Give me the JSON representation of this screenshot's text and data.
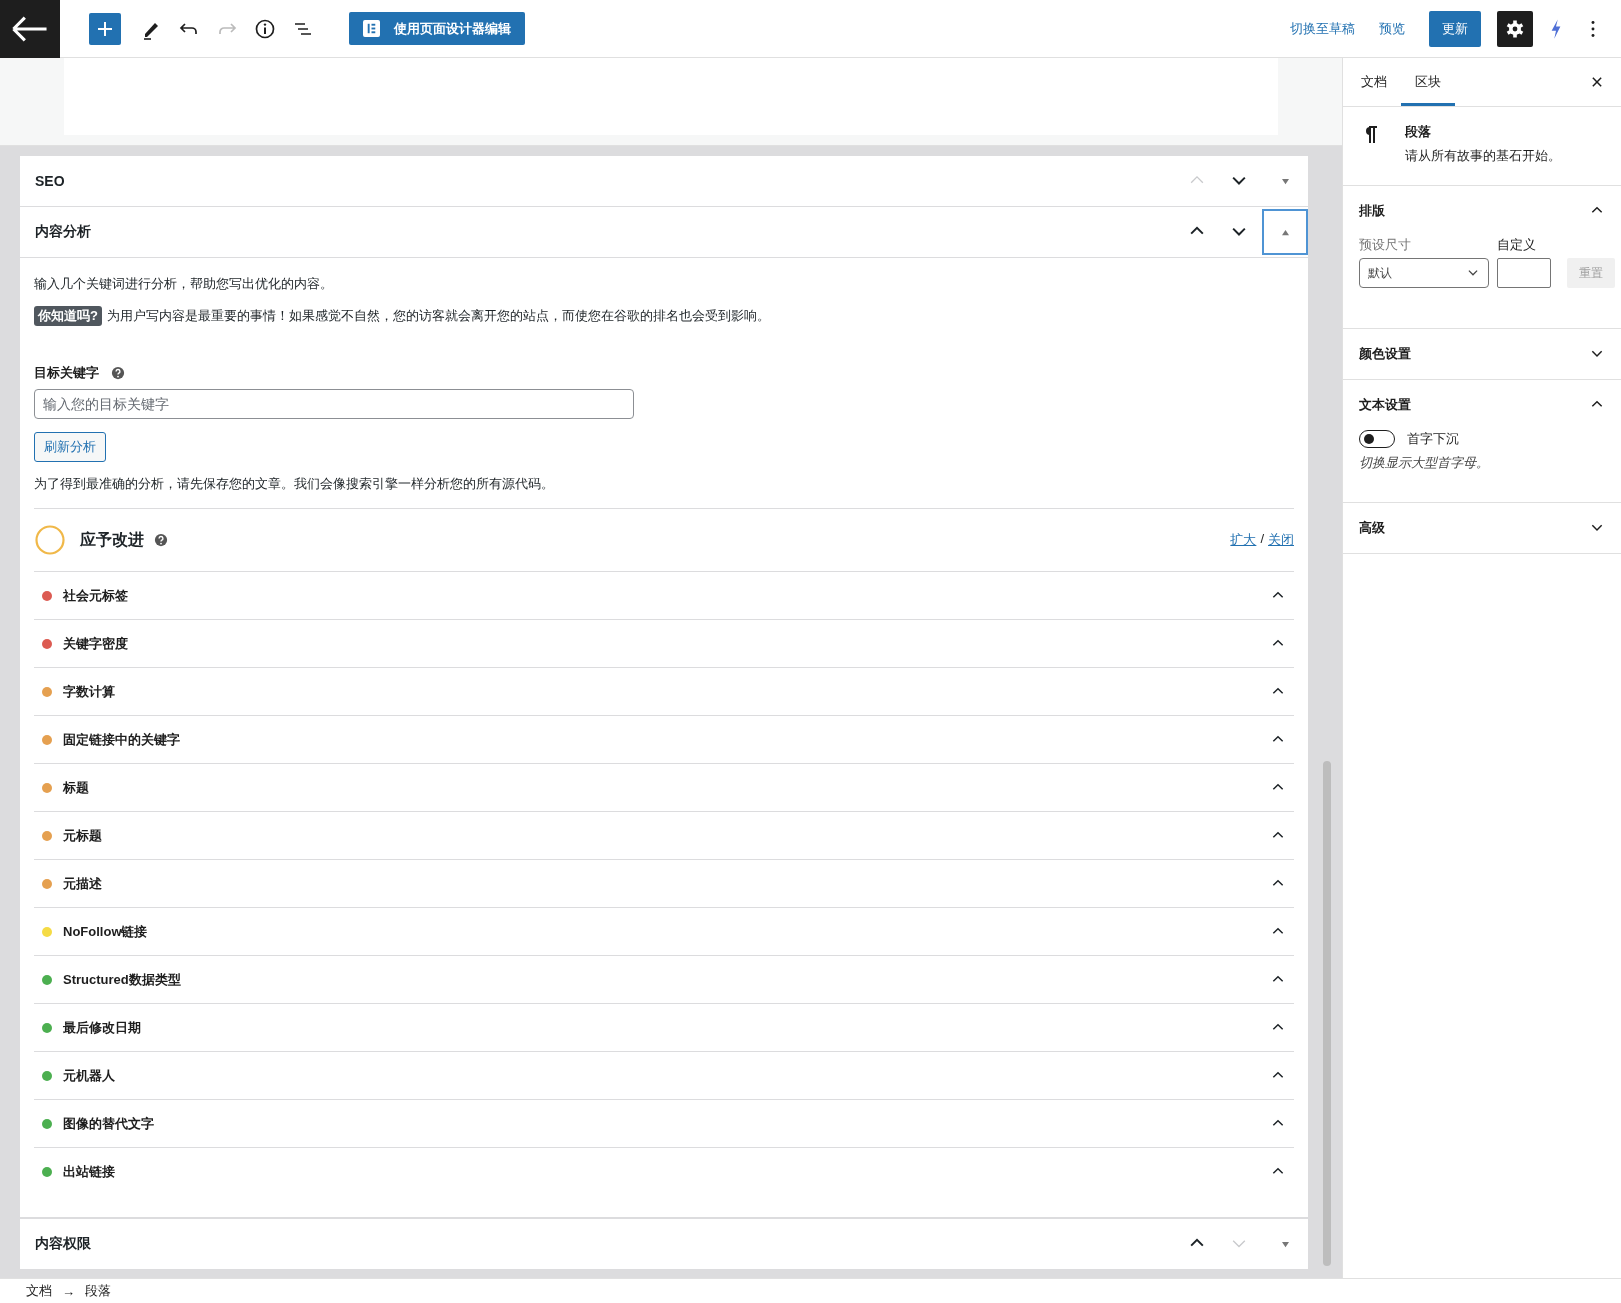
{
  "toolbar": {
    "design_button": "使用页面设计器编辑",
    "switch_draft": "切换至草稿",
    "preview": "预览",
    "update": "更新"
  },
  "metaboxes": [
    {
      "title": "SEO",
      "expanded": false,
      "focused": false,
      "up_disabled": true,
      "down_disabled": false
    },
    {
      "title": "内容分析",
      "expanded": true,
      "focused": true,
      "up_disabled": false,
      "down_disabled": false
    },
    {
      "title": "内容权限",
      "expanded": false,
      "focused": false,
      "up_disabled": false,
      "down_disabled": true
    }
  ],
  "analysis": {
    "intro": "输入几个关键词进行分析，帮助您写出优化的内容。",
    "tip_badge": "你知道吗?",
    "tip": "为用户写内容是最重要的事情！如果感觉不自然，您的访客就会离开您的站点，而使您在谷歌的排名也会受到影响。",
    "keyword_label": "目标关键字",
    "keyword_placeholder": "输入您的目标关键字",
    "refresh_button": "刷新分析",
    "note": "为了得到最准确的分析，请先保存您的文章。我们会像搜索引擎一样分析您的所有源代码。",
    "score_title": "应予改进",
    "expand_link": "扩大",
    "separator": "/",
    "close_link": "关闭",
    "checks": [
      {
        "label": "社会元标签",
        "color": "#dc5b52",
        "expanded": true
      },
      {
        "label": "关键字密度",
        "color": "#dc5b52",
        "expanded": true
      },
      {
        "label": "字数计算",
        "color": "#e5a050",
        "expanded": true
      },
      {
        "label": "固定链接中的关键字",
        "color": "#e5a050",
        "expanded": true
      },
      {
        "label": "标题",
        "color": "#e5a050",
        "expanded": true
      },
      {
        "label": "元标题",
        "color": "#e5a050",
        "expanded": true
      },
      {
        "label": "元描述",
        "color": "#e5a050",
        "expanded": true
      },
      {
        "label": "NoFollow链接",
        "color": "#f5db45",
        "expanded": true
      },
      {
        "label": "Structured数据类型",
        "color": "#4caf50",
        "expanded": true
      },
      {
        "label": "最后修改日期",
        "color": "#4caf50",
        "expanded": true
      },
      {
        "label": "元机器人",
        "color": "#4caf50",
        "expanded": true
      },
      {
        "label": "图像的替代文字",
        "color": "#4caf50",
        "expanded": true
      },
      {
        "label": "出站链接",
        "color": "#4caf50",
        "expanded": true
      }
    ]
  },
  "sidebar": {
    "tabs": [
      {
        "label": "文档",
        "selected": false
      },
      {
        "label": "区块",
        "selected": true
      }
    ],
    "block": {
      "title": "段落",
      "description": "请从所有故事的基石开始。"
    },
    "panels": [
      {
        "kind": "typography",
        "title": "排版",
        "expanded": true,
        "preset_label": "预设尺寸",
        "preset_value": "默认",
        "custom_label": "自定义",
        "reset_button": "重置",
        "reset_disabled": true
      },
      {
        "kind": "plain",
        "title": "颜色设置",
        "expanded": false
      },
      {
        "kind": "text",
        "title": "文本设置",
        "expanded": true,
        "toggle_label": "首字下沉",
        "toggle_on": false,
        "help": "切换显示大型首字母。"
      },
      {
        "kind": "plain",
        "title": "高级",
        "expanded": false
      }
    ]
  },
  "breadcrumb": [
    "文档",
    "段落"
  ],
  "breadcrumb_separator": "→"
}
